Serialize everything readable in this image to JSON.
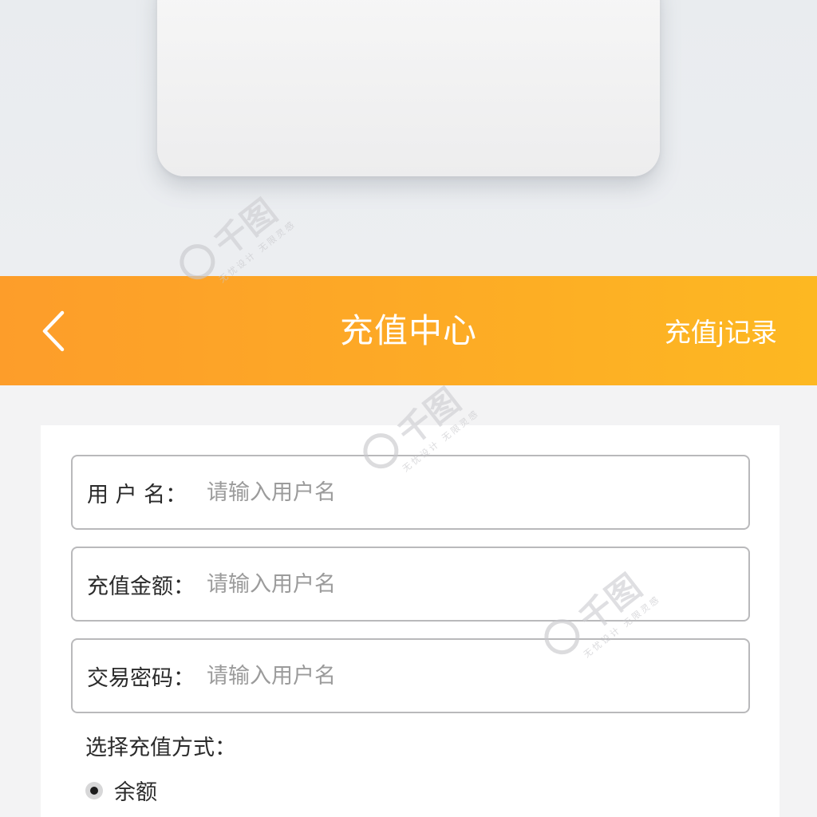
{
  "header": {
    "title": "充值中心",
    "right_link": "充值j记录",
    "back_icon": "chevron-left-icon"
  },
  "form": {
    "fields": [
      {
        "label": "用 户 名：",
        "placeholder": "请输入用户名"
      },
      {
        "label": "充值金额：",
        "placeholder": "请输入用户名"
      },
      {
        "label": "交易密码：",
        "placeholder": "请输入用户名"
      }
    ],
    "payment_section_title": "选择充值方式：",
    "payment_options": [
      {
        "label": "余额",
        "selected": true
      }
    ]
  },
  "watermark": {
    "brand": "千图",
    "tagline": "无忧设计 无限灵感"
  },
  "colors": {
    "header_start": "#fd9d2a",
    "header_end": "#fdb822",
    "page_bg": "#f3f3f4",
    "field_border": "#b9b9bb"
  }
}
